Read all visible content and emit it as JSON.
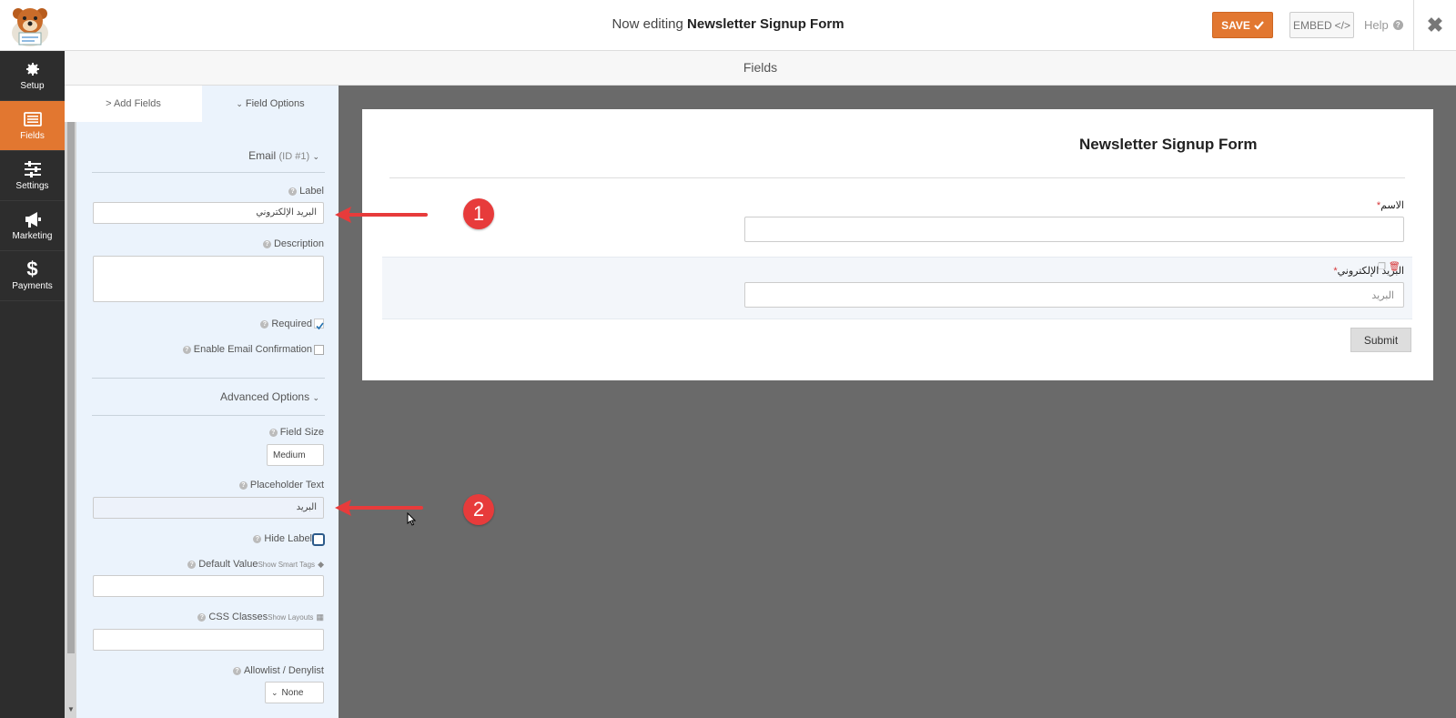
{
  "header": {
    "title_prefix": "Now editing",
    "title_name": "Newsletter Signup Form",
    "save_label": "SAVE",
    "embed_label": "EMBED",
    "embed_icon": "</>",
    "help_label": "Help"
  },
  "nav": {
    "items": [
      {
        "label": "Setup",
        "icon": "gear-icon"
      },
      {
        "label": "Fields",
        "icon": "list-icon",
        "active": true
      },
      {
        "label": "Settings",
        "icon": "sliders-icon"
      },
      {
        "label": "Marketing",
        "icon": "megaphone-icon"
      },
      {
        "label": "Payments",
        "icon": "dollar-icon"
      }
    ]
  },
  "section_title": "Fields",
  "tabs": {
    "add_fields": "> Add Fields",
    "field_options": "Field Options"
  },
  "panel": {
    "field_heading": "Email",
    "field_id": "(ID #1)",
    "label_title": "Label",
    "label_value": "البريد الإلكتروني",
    "description_title": "Description",
    "required_label": "Required",
    "email_confirmation_label": "Enable Email Confirmation",
    "advanced_title": "Advanced Options",
    "field_size_title": "Field Size",
    "field_size_value": "Medium",
    "placeholder_title": "Placeholder Text",
    "placeholder_value": "البريد",
    "hide_label": "Hide Label",
    "default_value_title": "Default Value",
    "smart_tags_link": "Show Smart Tags",
    "css_classes_title": "CSS Classes",
    "layouts_link": "Show Layouts",
    "allowlist_title": "Allowlist / Denylist",
    "allowlist_value": "None"
  },
  "form": {
    "title": "Newsletter Signup Form",
    "name_label": "الاسم",
    "email_label": "البريد الإلكتروني",
    "email_placeholder": "البريد",
    "submit_label": "Submit"
  },
  "annotations": {
    "badge_1": "1",
    "badge_2": "2"
  },
  "colors": {
    "accent": "#e27730",
    "annotation": "#e73b3b",
    "nav_bg": "#2d2d2d",
    "panel_bg": "#ebf3fc"
  }
}
